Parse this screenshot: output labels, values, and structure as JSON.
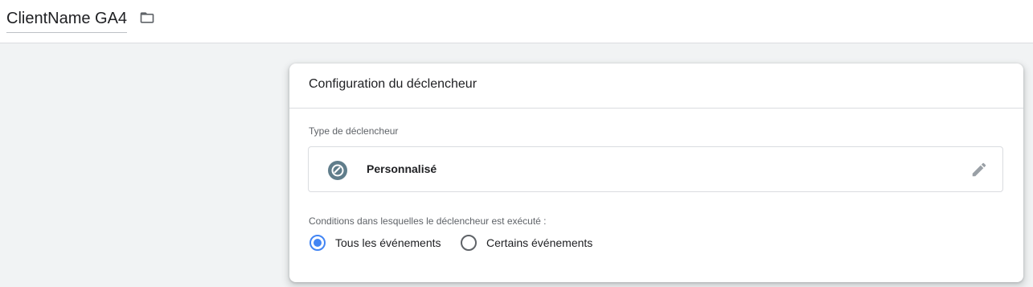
{
  "header": {
    "container_name": "ClientName GA4",
    "folder_icon": "folder-icon"
  },
  "card": {
    "title": "Configuration du déclencheur",
    "trigger_type_label": "Type de déclencheur",
    "trigger_type": {
      "icon": "custom-event-icon",
      "name": "Personnalisé",
      "edit_icon": "pencil-icon"
    },
    "conditions_label": "Conditions dans lesquelles le déclencheur est exécuté :",
    "options": [
      {
        "label": "Tous les événements",
        "selected": true
      },
      {
        "label": "Certains événements",
        "selected": false
      }
    ]
  },
  "colors": {
    "accent": "#4285f4",
    "icon_bg": "#607d8b",
    "background": "#f1f3f4"
  }
}
